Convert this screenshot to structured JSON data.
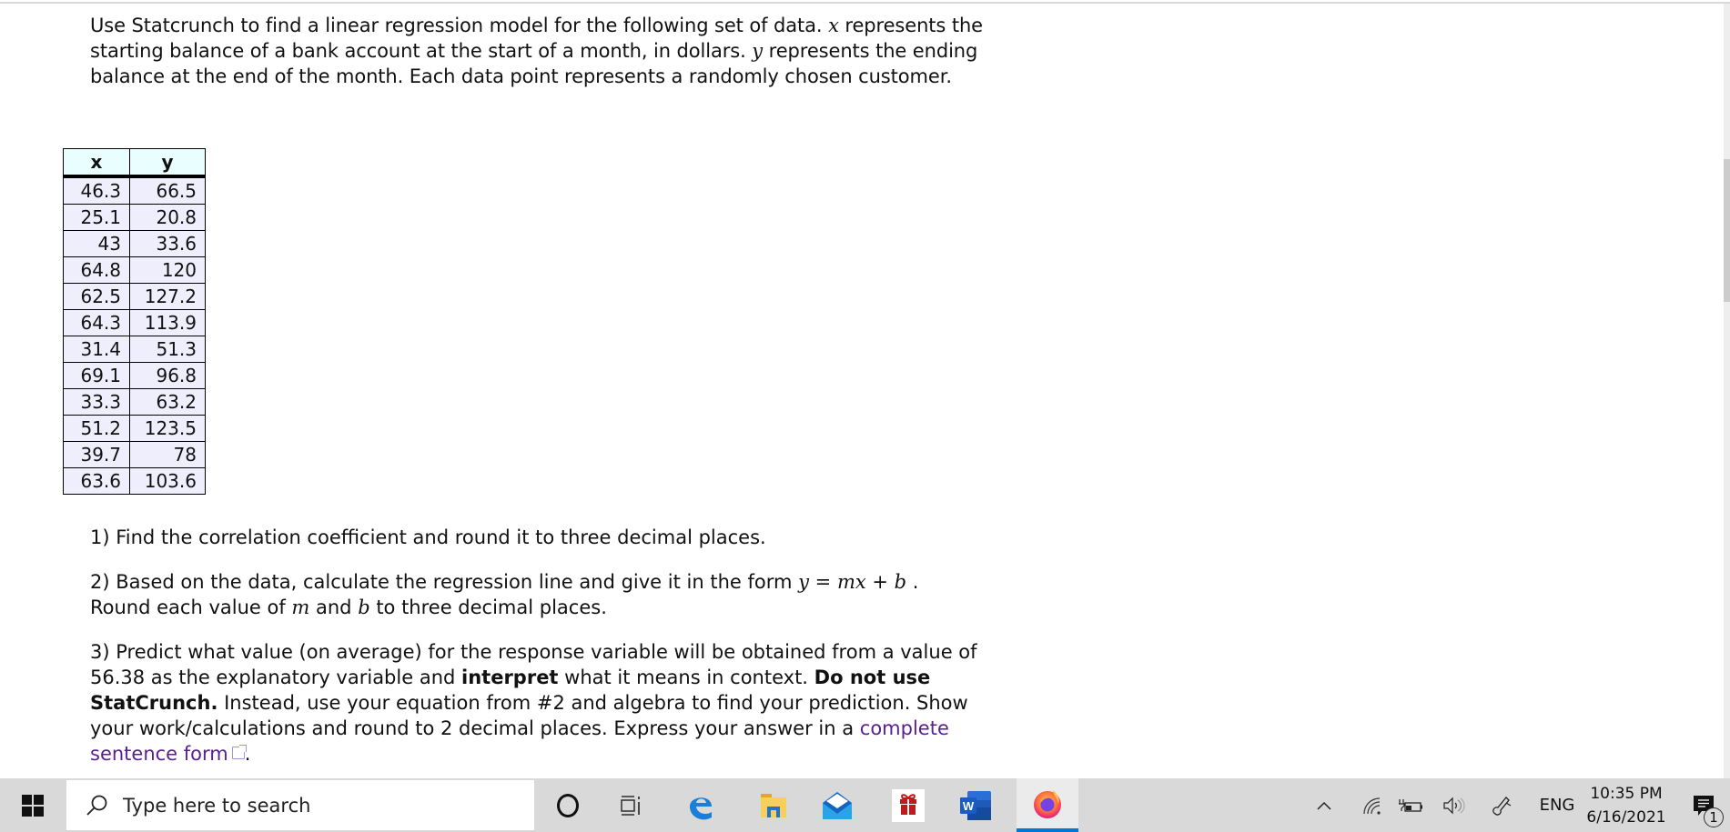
{
  "document": {
    "intro": {
      "part1": "Use Statcrunch to find a linear regression model for the following set of data. ",
      "x_var": "x",
      "part2": " represents the starting balance of a bank account at the start of a month, in dollars. ",
      "y_var": "y",
      "part3": " represents the ending balance at the end of the month. Each data point represents a randomly chosen customer."
    },
    "table": {
      "headers": [
        "x",
        "y"
      ],
      "rows": [
        [
          "46.3",
          "66.5"
        ],
        [
          "25.1",
          "20.8"
        ],
        [
          "43",
          "33.6"
        ],
        [
          "64.8",
          "120"
        ],
        [
          "62.5",
          "127.2"
        ],
        [
          "64.3",
          "113.9"
        ],
        [
          "31.4",
          "51.3"
        ],
        [
          "69.1",
          "96.8"
        ],
        [
          "33.3",
          "63.2"
        ],
        [
          "51.2",
          "123.5"
        ],
        [
          "39.7",
          "78"
        ],
        [
          "63.6",
          "103.6"
        ]
      ]
    },
    "questions": {
      "q1": "1) Find the correlation coefficient and round it to three decimal places.",
      "q2": {
        "part1": "2) Based on the data, calculate the regression line and give it in the form ",
        "formula_y": "y",
        "formula_eq": " = ",
        "formula_mx": "mx",
        "formula_plus": " + ",
        "formula_b": "b",
        "part2": " .",
        "part3": "Round each value of ",
        "m": "m",
        "and": " and ",
        "b": "b",
        "part4": " to three decimal places."
      },
      "q3": {
        "part1": "3) Predict what value (on average) for the response variable will be obtained from a value of 56.38 as the explanatory variable and ",
        "bold1": "interpret",
        "part2": " what it means in context. ",
        "bold2": "Do not use StatCrunch.",
        "part3": " Instead, use your equation from #2 and algebra to find your prediction. Show your work/calculations and round to 2 decimal places. Express your answer in a ",
        "link": "complete sentence form",
        "part4": "."
      }
    }
  },
  "taskbar": {
    "search_placeholder": "Type here to search",
    "apps": [
      "cortana",
      "task-view",
      "edge",
      "file-explorer",
      "mail",
      "gift",
      "word",
      "firefox"
    ],
    "active_app": "firefox",
    "tray": {
      "language": "ENG",
      "time": "10:35 PM",
      "date": "6/16/2021",
      "notification_count": "1"
    }
  },
  "colors": {
    "table_header_bg": "#e8feff",
    "table_cell_bg": "#eeeefc",
    "link": "#5a1e96",
    "taskbar_bg": "#d9d9d9",
    "active_indicator": "#0078d7"
  }
}
